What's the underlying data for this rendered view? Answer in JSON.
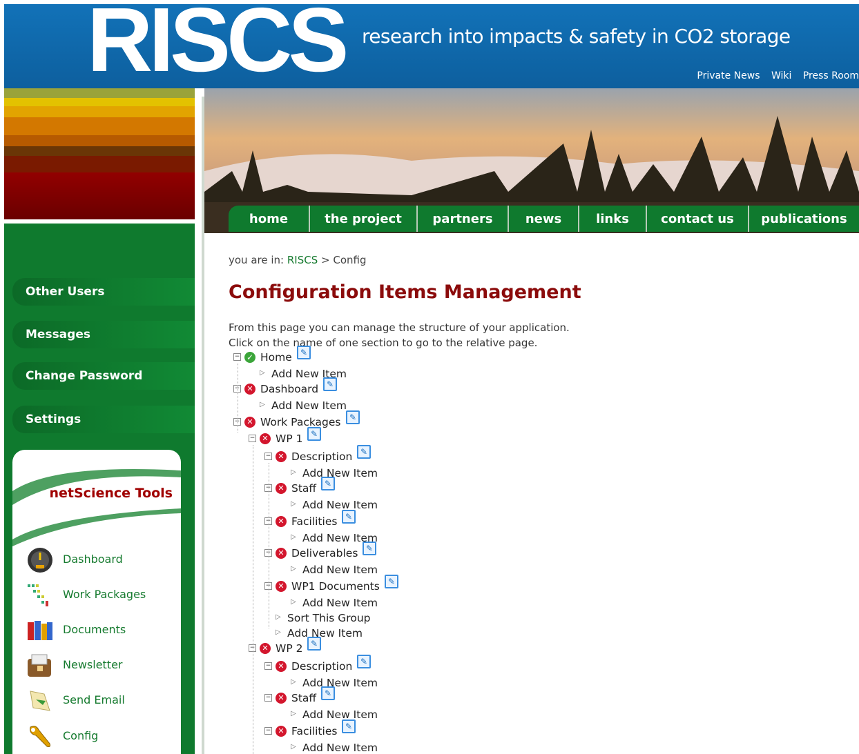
{
  "header": {
    "logo": "RISCS",
    "tagline": "research into impacts & safety in CO2 storage",
    "links": [
      "Private News",
      "Wiki",
      "Press Room"
    ]
  },
  "nav": [
    "home",
    "the project",
    "partners",
    "news",
    "links",
    "contact us",
    "publications"
  ],
  "sidebar": {
    "menu": [
      "Other Users",
      "Messages",
      "Change Password",
      "Settings"
    ],
    "tools_title": "netScience Tools",
    "tools": [
      {
        "label": "Dashboard",
        "icon": "speedometer-icon"
      },
      {
        "label": "Work Packages",
        "icon": "work-packages-icon"
      },
      {
        "label": "Documents",
        "icon": "binders-icon"
      },
      {
        "label": "Newsletter",
        "icon": "newsletter-icon"
      },
      {
        "label": "Send Email",
        "icon": "send-email-icon"
      },
      {
        "label": "Config",
        "icon": "wrench-icon"
      }
    ]
  },
  "breadcrumb": {
    "prefix": "you are in:",
    "root": "RISCS",
    "sep": ">",
    "current": "Config"
  },
  "page_title": "Configuration Items Management",
  "intro": [
    "From this page you can manage the structure of your application.",
    "Click on the name of one section to go to the relative page."
  ],
  "tree": [
    {
      "label": "Home",
      "kind": "node",
      "status": "ok",
      "depth": 0
    },
    {
      "label": "Add New Item",
      "kind": "action",
      "depth": 0
    },
    {
      "label": "Dashboard",
      "kind": "node",
      "status": "off",
      "depth": 0
    },
    {
      "label": "Add New Item",
      "kind": "action",
      "depth": 0
    },
    {
      "label": "Work Packages",
      "kind": "node",
      "status": "off",
      "depth": 0
    },
    {
      "label": "WP 1",
      "kind": "node",
      "status": "off",
      "depth": 1
    },
    {
      "label": "Description",
      "kind": "node",
      "status": "off",
      "depth": 2
    },
    {
      "label": "Add New Item",
      "kind": "action",
      "depth": 2
    },
    {
      "label": "Staff",
      "kind": "node",
      "status": "off",
      "depth": 2
    },
    {
      "label": "Add New Item",
      "kind": "action",
      "depth": 2
    },
    {
      "label": "Facilities",
      "kind": "node",
      "status": "off",
      "depth": 2
    },
    {
      "label": "Add New Item",
      "kind": "action",
      "depth": 2
    },
    {
      "label": "Deliverables",
      "kind": "node",
      "status": "off",
      "depth": 2
    },
    {
      "label": "Add New Item",
      "kind": "action",
      "depth": 2
    },
    {
      "label": "WP1 Documents",
      "kind": "node",
      "status": "off",
      "depth": 2
    },
    {
      "label": "Add New Item",
      "kind": "action",
      "depth": 2
    },
    {
      "label": "Sort This Group",
      "kind": "action",
      "depth": 1
    },
    {
      "label": "Add New Item",
      "kind": "action",
      "depth": 1
    },
    {
      "label": "WP 2",
      "kind": "node",
      "status": "off",
      "depth": 1
    },
    {
      "label": "Description",
      "kind": "node",
      "status": "off",
      "depth": 2
    },
    {
      "label": "Add New Item",
      "kind": "action",
      "depth": 2
    },
    {
      "label": "Staff",
      "kind": "node",
      "status": "off",
      "depth": 2
    },
    {
      "label": "Add New Item",
      "kind": "action",
      "depth": 2
    },
    {
      "label": "Facilities",
      "kind": "node",
      "status": "off",
      "depth": 2
    },
    {
      "label": "Add New Item",
      "kind": "action",
      "depth": 2
    }
  ],
  "colors": {
    "green": "#0f7a2e",
    "blue": "#1272b8",
    "title_red": "#8b0b0b"
  }
}
